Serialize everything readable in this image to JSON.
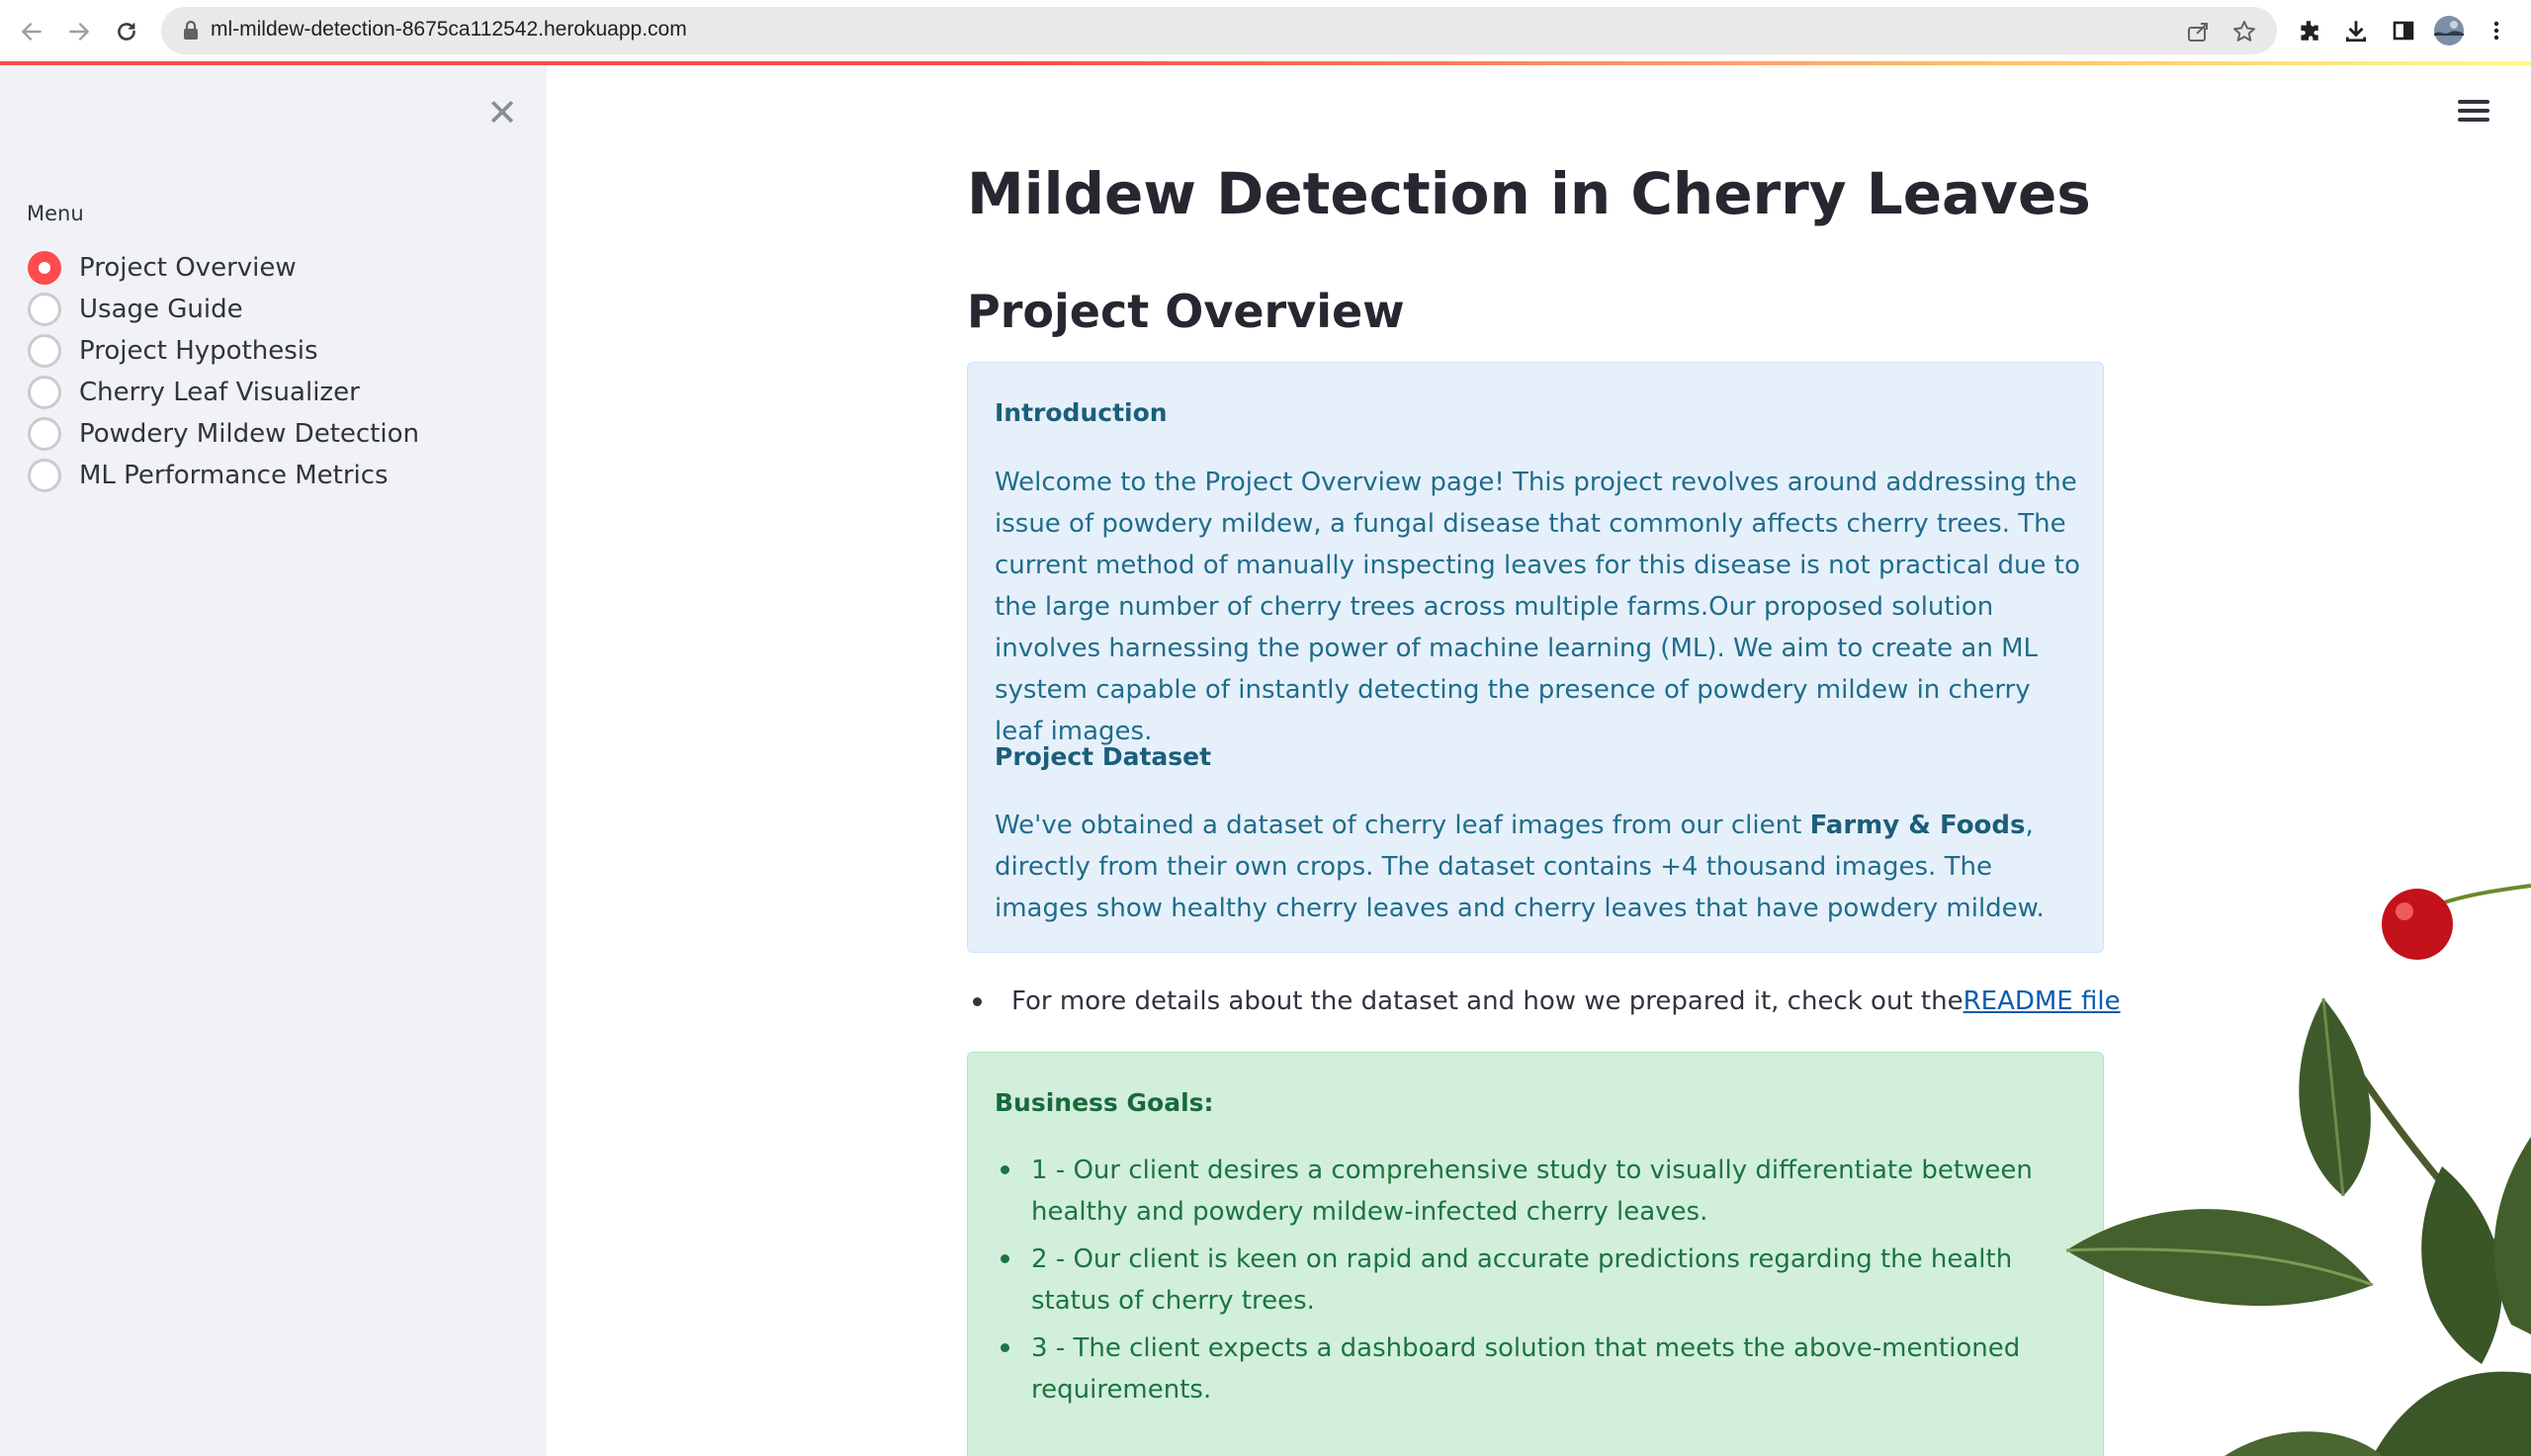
{
  "browser": {
    "url": "ml-mildew-detection-8675ca112542.herokuapp.com"
  },
  "sidebar": {
    "menu_label": "Menu",
    "items": [
      {
        "label": "Project Overview",
        "selected": true
      },
      {
        "label": "Usage Guide",
        "selected": false
      },
      {
        "label": "Project Hypothesis",
        "selected": false
      },
      {
        "label": "Cherry Leaf Visualizer",
        "selected": false
      },
      {
        "label": "Powdery Mildew Detection",
        "selected": false
      },
      {
        "label": "ML Performance Metrics",
        "selected": false
      }
    ]
  },
  "main": {
    "title": "Mildew Detection in Cherry Leaves",
    "subtitle": "Project Overview",
    "info": {
      "intro_heading": "Introduction",
      "intro_text": "Welcome to the Project Overview page! This project revolves around addressing the issue of powdery mildew, a fungal disease that commonly affects cherry trees. The current method of manually inspecting leaves for this disease is not practical due to the large number of cherry trees across multiple farms.Our proposed solution involves harnessing the power of machine learning (ML). We aim to create an ML system capable of instantly detecting the presence of powdery mildew in cherry leaf images.",
      "dataset_heading": "Project Dataset",
      "dataset_text_before": "We've obtained a dataset of cherry leaf images from our client ",
      "dataset_client": "Farmy & Foods",
      "dataset_text_after": ", directly from their own crops. The dataset contains +4 thousand images. The images show healthy cherry leaves and cherry leaves that have powdery mildew."
    },
    "readme_line": {
      "text": "For more details about the dataset and how we prepared it, check out the ",
      "link": "README file"
    },
    "goals": {
      "heading": "Business Goals:",
      "items": [
        "1 - Our client desires a comprehensive study to visually differentiate between healthy and powdery mildew-infected cherry leaves.",
        "2 - Our client is keen on rapid and accurate predictions regarding the health status of cherry trees.",
        "3 - The client expects a dashboard solution that meets the above-mentioned requirements."
      ]
    }
  },
  "colors": {
    "accent": "#ff4b4b",
    "sidebar_bg": "#f0f2f6",
    "info_bg": "#e6f0fb",
    "success_bg": "#d2efdc"
  }
}
